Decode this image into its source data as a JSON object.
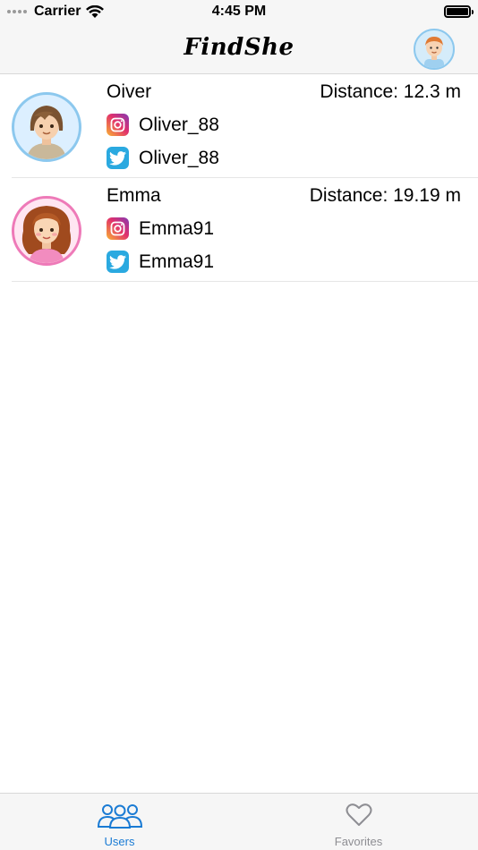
{
  "status_bar": {
    "carrier": "Carrier",
    "time": "4:45 PM"
  },
  "nav": {
    "title": "FindShe",
    "profile_icon": "user-avatar-icon"
  },
  "users": [
    {
      "name": "Oiver",
      "distance": "Distance: 12.3 m",
      "instagram": "Oliver_88",
      "twitter": "Oliver_88",
      "avatar": "male-avatar",
      "avatar_ring_color": "#8cc8ee"
    },
    {
      "name": "Emma",
      "distance": "Distance: 19.19 m",
      "instagram": "Emma91",
      "twitter": "Emma91",
      "avatar": "female-avatar",
      "avatar_ring_color": "#ee7ab8"
    }
  ],
  "tabs": [
    {
      "label": "Users",
      "icon": "users-icon",
      "active": true
    },
    {
      "label": "Favorites",
      "icon": "heart-icon",
      "active": false
    }
  ],
  "colors": {
    "accent": "#1a7bd4",
    "inactive": "#8e8e93",
    "twitter": "#2aa9e0"
  }
}
